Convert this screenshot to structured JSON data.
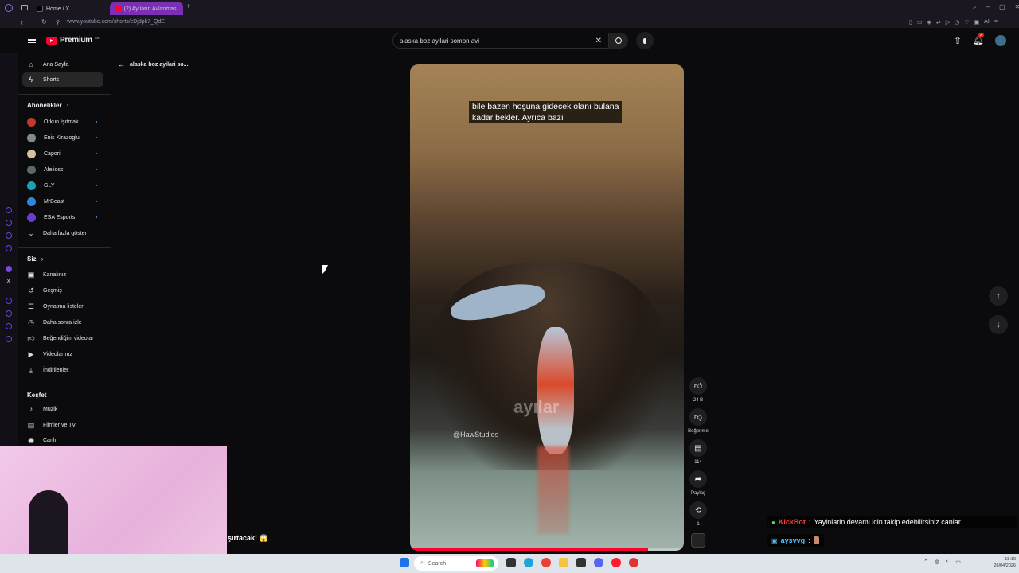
{
  "browser": {
    "tabs": [
      {
        "label": "Home / X",
        "active": false
      },
      {
        "label": "(2) Ayıların Avlanmas...",
        "active": true
      }
    ],
    "url": "www.youtube.com/shorts/cDjdpk7_QdE",
    "extension_label": "AI"
  },
  "header": {
    "logo_text": "Premium",
    "logo_region": "GB",
    "search_value": "alaska boz ayilari somon avi",
    "notification_count": "2"
  },
  "back_link": "alaska boz ayilari so...",
  "sidebar": {
    "main": [
      {
        "label": "Ana Sayfa",
        "icon": "home-icon"
      },
      {
        "label": "Shorts",
        "icon": "shorts-icon",
        "active": true
      }
    ],
    "subscriptions_title": "Abonelikler",
    "subscriptions": [
      {
        "label": "Orkun Işıtmak",
        "color": "#c0392b"
      },
      {
        "label": "Enis Kirazoglu",
        "color": "#7f8c8d"
      },
      {
        "label": "Capori",
        "color": "#d4c39a"
      },
      {
        "label": "Afelioss",
        "color": "#5a6a6a"
      },
      {
        "label": "GLY",
        "color": "#17a2b8"
      },
      {
        "label": "MrBeast",
        "color": "#2e86de"
      },
      {
        "label": "ESA Esports",
        "color": "#6c3bd6"
      }
    ],
    "show_more": "Daha fazla göster",
    "you_title": "Siz",
    "you": [
      {
        "label": "Kanalınız",
        "icon": "channel-icon"
      },
      {
        "label": "Geçmiş",
        "icon": "history-icon"
      },
      {
        "label": "Oynatma listeleri",
        "icon": "playlist-icon"
      },
      {
        "label": "Daha sonra izle",
        "icon": "clock-icon"
      },
      {
        "label": "Beğendiğim videolar",
        "icon": "like-icon"
      },
      {
        "label": "Videolarınız",
        "icon": "video-icon"
      },
      {
        "label": "İndirilenler",
        "icon": "download-icon"
      }
    ],
    "explore_title": "Keşfet",
    "explore": [
      {
        "label": "Müzik",
        "icon": "music-icon"
      },
      {
        "label": "Filmler ve TV",
        "icon": "film-icon"
      },
      {
        "label": "Canlı",
        "icon": "live-icon"
      }
    ]
  },
  "video": {
    "subtitle_line1": "bile bazen hoşuna gidecek olanı bulana",
    "subtitle_line2": "kadar bekler. Ayrıca bazı",
    "watermark": "ayılar",
    "credit": "@HawStudios",
    "progress": 0.87
  },
  "actions": {
    "likes": "24 B",
    "dislike_label": "Beğenme",
    "comments": "114",
    "share_label": "Paylaş",
    "remix_count": "1"
  },
  "overlay": {
    "cam_text": "şırtacak! 😱",
    "chat": [
      {
        "user": "KickBot",
        "user_color": "#ff3b3b",
        "message": "Yayinlarin devami icin takip edebilirsiniz canlar....."
      },
      {
        "user": "aysvvg",
        "user_color": "#5fc2ff",
        "message": ""
      }
    ]
  },
  "taskbar": {
    "search_placeholder": "Search",
    "time": "18:10",
    "date": "26/04/2026"
  }
}
